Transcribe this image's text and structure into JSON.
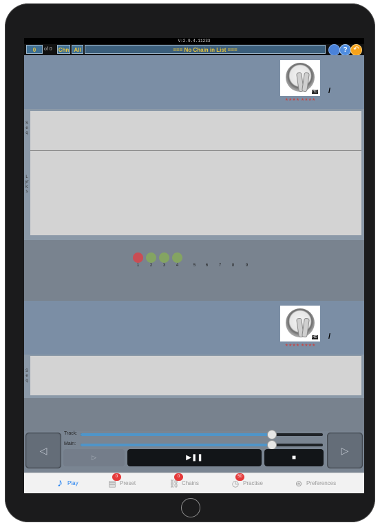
{
  "version": "V:2.9.4.11233",
  "topbar": {
    "count": "0",
    "of_label": "of 0",
    "chn_label": "Chn",
    "all_label": "All",
    "chain_title": "=== No Chain in List ===",
    "help_label": "?",
    "back_label": "↶"
  },
  "track1": {
    "stars": "★★★★ ★★★★",
    "marker": "/",
    "seq_label": "Seq",
    "lyrics_label": "Lyrics"
  },
  "sequence": {
    "numbers": [
      "1",
      "2",
      "3",
      "4",
      "5",
      "6",
      "7",
      "8",
      "9"
    ],
    "colors": {
      "red": "#c94d54",
      "green": "#84a462"
    }
  },
  "track2": {
    "stars": "★★★★ ★★★★",
    "marker": "/",
    "seq_label": "Seq"
  },
  "mixer": {
    "track_label": "Track:",
    "main_label": "Main:",
    "track_level": 0.79,
    "main_level": 0.79
  },
  "transport": {
    "prev": "◁",
    "next_song": "▷",
    "play_pause": "▶❚❚",
    "stop": "■",
    "next": "▷"
  },
  "tabs": [
    {
      "label": "Play",
      "icon": "music-note-icon",
      "badge": ""
    },
    {
      "label": "Preset",
      "icon": "document-icon",
      "badge": "0"
    },
    {
      "label": "Chains",
      "icon": "link-icon",
      "badge": "0"
    },
    {
      "label": "Practise",
      "icon": "timer-icon",
      "badge": "50"
    },
    {
      "label": "Preferences",
      "icon": "steering-wheel-icon",
      "badge": ""
    }
  ],
  "accent_color": "#1d7ef0"
}
